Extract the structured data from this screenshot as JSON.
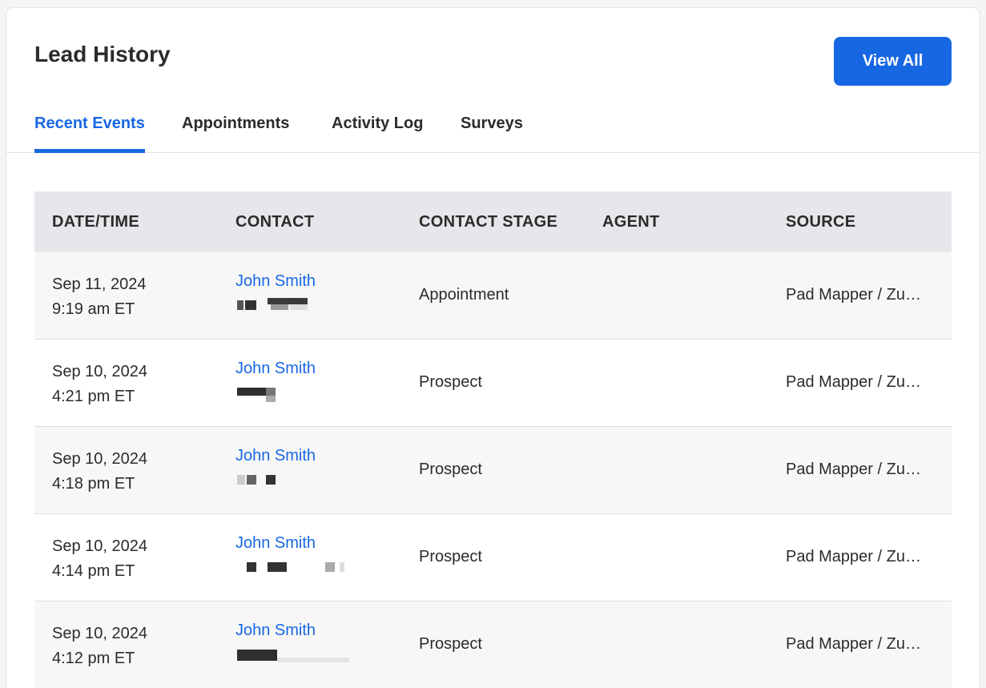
{
  "card": {
    "title": "Lead History",
    "view_all_label": "View All"
  },
  "tabs": [
    {
      "label": "Recent Events",
      "active": true
    },
    {
      "label": "Appointments",
      "active": false
    },
    {
      "label": "Activity Log",
      "active": false
    },
    {
      "label": "Surveys",
      "active": false
    }
  ],
  "table": {
    "headers": [
      "DATE/TIME",
      "CONTACT",
      "CONTACT STAGE",
      "AGENT",
      "SOURCE"
    ],
    "rows": [
      {
        "date": "Sep 11, 2024",
        "time": "9:19 am ET",
        "contact": "John Smith",
        "stage": "Appointment",
        "agent": "",
        "source": "Pad Mapper / Zumper"
      },
      {
        "date": "Sep 10, 2024",
        "time": "4:21 pm ET",
        "contact": "John Smith",
        "stage": "Prospect",
        "agent": "",
        "source": "Pad Mapper / Zumper"
      },
      {
        "date": "Sep 10, 2024",
        "time": "4:18 pm ET",
        "contact": "John Smith",
        "stage": "Prospect",
        "agent": "",
        "source": "Pad Mapper / Zumper"
      },
      {
        "date": "Sep 10, 2024",
        "time": "4:14 pm ET",
        "contact": "John Smith",
        "stage": "Prospect",
        "agent": "",
        "source": "Pad Mapper / Zumper"
      },
      {
        "date": "Sep 10, 2024",
        "time": "4:12 pm ET",
        "contact": "John Smith",
        "stage": "Prospect",
        "agent": "",
        "source": "Pad Mapper / Zumper"
      }
    ]
  },
  "colors": {
    "accent": "#1767e3",
    "header_bg": "#e6e7ea",
    "row_alt_bg": "#f7f7f8"
  }
}
